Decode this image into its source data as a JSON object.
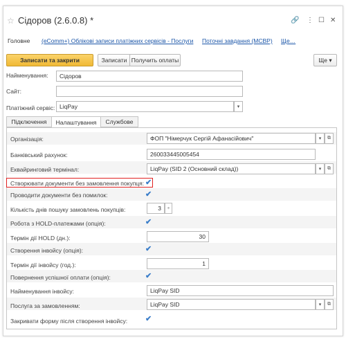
{
  "window": {
    "title": "Сідоров (2.6.0.8) *",
    "controls": [
      "🔗",
      "⋮",
      "☐",
      "✕"
    ]
  },
  "nav": {
    "main": "Головне",
    "link1": "(eComm+) Облікові записи платіжних сервісів - Послуги",
    "link2": "Поточні завдання (МСВР)",
    "more": "Ще…"
  },
  "toolbar": {
    "save_close": "Записати та закрити",
    "save": "Записати",
    "get_payments": "Получить оплаты",
    "more": "Ще"
  },
  "header": {
    "name_label": "Найменування:",
    "name_value": "Сідоров",
    "site_label": "Сайт:",
    "site_value": "",
    "service_label": "Платіжний сервіс:",
    "service_value": "LiqPay"
  },
  "tabs": [
    "Підключення",
    "Налаштування",
    "Службове"
  ],
  "form": {
    "org_label": "Організація:",
    "org_value": "ФОП \"Німерчук Сергій Афанасійович\"",
    "bank_label": "Банківський рахунок:",
    "bank_value": "260033445005454",
    "term_label": "Еквайринговий термінал:",
    "term_value": "LiqPay (SID 2 (Основний склад))",
    "create_docs_label": "Створювати документи без замовлення покупця:",
    "no_errors_label": "Проводити документи без помилок:",
    "days_label": "Кількість днів пошуку замовлень покупців:",
    "days_value": "3",
    "hold_label": "Робота з HOLD-платежами (опція):",
    "hold_days_label": "Термін дії HOLD (дн.):",
    "hold_days_value": "30",
    "invoice_label": "Створення інвойсу (опція):",
    "invoice_hours_label": "Термін дії інвойсу (год.):",
    "invoice_hours_value": "1",
    "refund_label": "Повернення успішної оплати (опція):",
    "invoice_name_label": "Найменування інвойсу:",
    "invoice_name_value": "LiqPay SID",
    "service_order_label": "Послуга за замовленням:",
    "service_order_value": "LiqPay SID",
    "close_form_label": "Закривати форму після створення інвойсу:"
  }
}
